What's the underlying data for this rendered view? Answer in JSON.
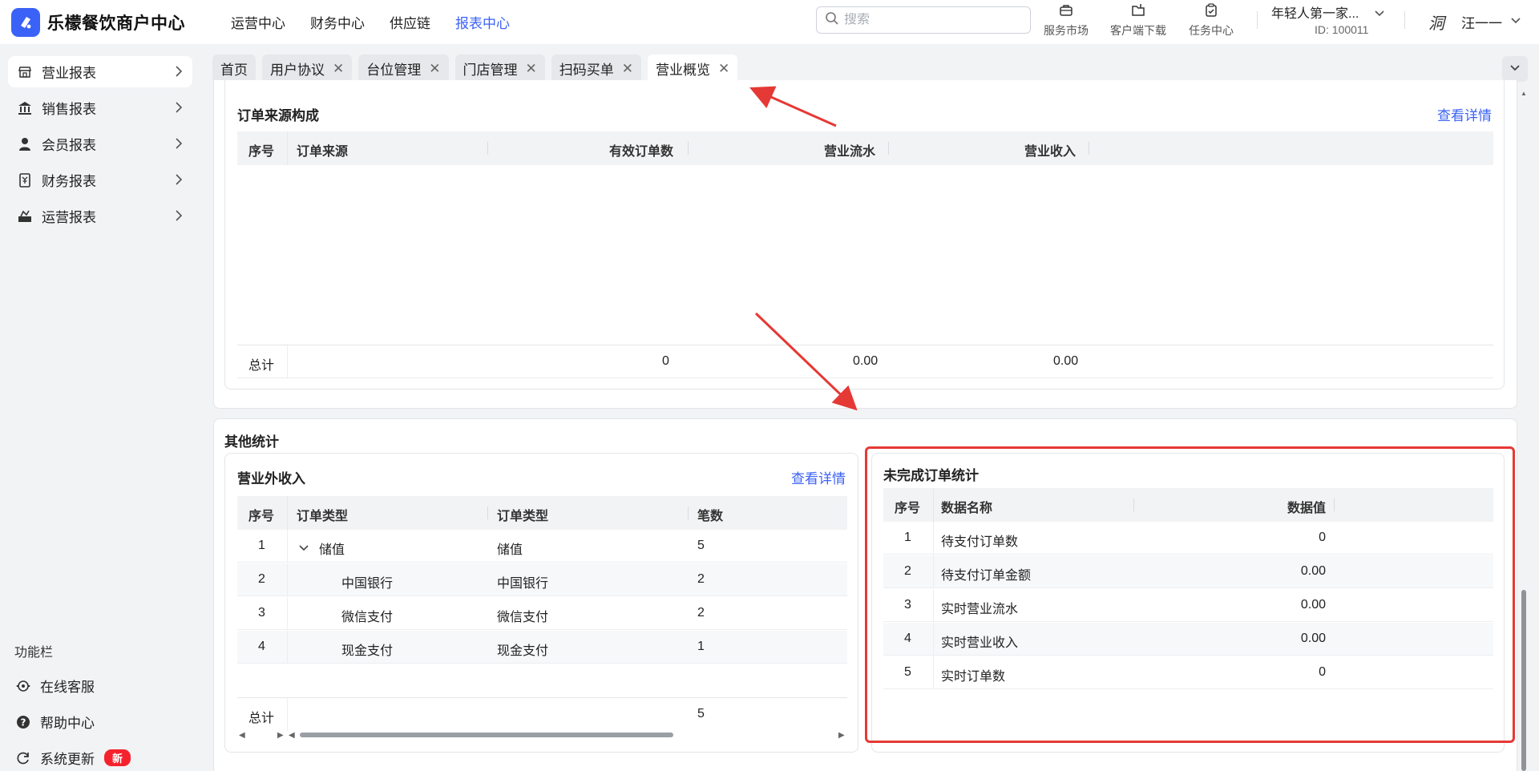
{
  "app": {
    "title": "乐檬餐饮商户中心"
  },
  "topnav": [
    {
      "label": "运营中心",
      "active": false
    },
    {
      "label": "财务中心",
      "active": false
    },
    {
      "label": "供应链",
      "active": false
    },
    {
      "label": "报表中心",
      "active": true
    }
  ],
  "search": {
    "placeholder": "搜索",
    "value": ""
  },
  "tools": {
    "market": "服务市场",
    "download": "客户端下载",
    "tasks": "任务中心"
  },
  "store": {
    "name": "年轻人第一家...",
    "id": "ID: 100011"
  },
  "user": {
    "avatar_text": "洞",
    "name": "汪一一"
  },
  "sidebar": {
    "items": [
      {
        "label": "营业报表",
        "icon": "store-icon"
      },
      {
        "label": "销售报表",
        "icon": "bank-icon"
      },
      {
        "label": "会员报表",
        "icon": "user-icon"
      },
      {
        "label": "财务报表",
        "icon": "ledger-icon"
      },
      {
        "label": "运营报表",
        "icon": "operations-icon"
      }
    ],
    "function_title": "功能栏",
    "functions": [
      {
        "label": "在线客服",
        "icon": "customer-service-icon"
      },
      {
        "label": "帮助中心",
        "icon": "help-icon"
      },
      {
        "label": "系统更新",
        "icon": "refresh-icon",
        "badge": "新"
      }
    ]
  },
  "tabs": [
    {
      "label": "首页",
      "closable": false
    },
    {
      "label": "用户协议",
      "closable": true
    },
    {
      "label": "台位管理",
      "closable": true
    },
    {
      "label": "门店管理",
      "closable": true
    },
    {
      "label": "扫码买单",
      "closable": true
    },
    {
      "label": "营业概览",
      "closable": true,
      "active": true
    }
  ],
  "order_source": {
    "title": "订单来源构成",
    "detail_link": "查看详情",
    "columns": [
      "序号",
      "订单来源",
      "有效订单数",
      "营业流水",
      "营业收入"
    ],
    "rows": [],
    "total": {
      "label": "总计",
      "orders": "0",
      "flow": "0.00",
      "income": "0.00"
    }
  },
  "other_stats": {
    "title": "其他统计",
    "non_business_income": {
      "title": "营业外收入",
      "detail_link": "查看详情",
      "columns": [
        "序号",
        "订单类型",
        "订单类型",
        "笔数"
      ],
      "rows": [
        {
          "index": "1",
          "name": "储值",
          "type": "储值",
          "count": "5",
          "expanded": true
        },
        {
          "index": "2",
          "name": "中国银行",
          "type": "中国银行",
          "count": "2"
        },
        {
          "index": "3",
          "name": "微信支付",
          "type": "微信支付",
          "count": "2"
        },
        {
          "index": "4",
          "name": "现金支付",
          "type": "现金支付",
          "count": "1"
        }
      ],
      "total": {
        "label": "总计",
        "count": "5"
      }
    },
    "unfinished_orders": {
      "title": "未完成订单统计",
      "columns": [
        "序号",
        "数据名称",
        "数据值"
      ],
      "rows": [
        {
          "index": "1",
          "name": "待支付订单数",
          "value": "0"
        },
        {
          "index": "2",
          "name": "待支付订单金额",
          "value": "0.00"
        },
        {
          "index": "3",
          "name": "实时营业流水",
          "value": "0.00"
        },
        {
          "index": "4",
          "name": "实时营业收入",
          "value": "0.00"
        },
        {
          "index": "5",
          "name": "实时订单数",
          "value": "0"
        }
      ]
    }
  },
  "colors": {
    "accent": "#3b62f6",
    "annotation": "#e53935",
    "badge": "#f5222d"
  }
}
